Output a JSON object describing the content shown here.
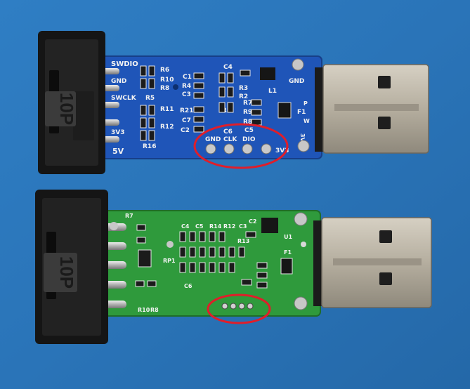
{
  "colors": {
    "background": "#2a74b8",
    "blue_pcb": "#1f55b8",
    "green_pcb": "#2f9a3c",
    "annotation_circle": "#e01e2a",
    "connector_body": "#151515",
    "usb_metal": "#b9b2a4"
  },
  "icons": [
    "10-pin-idc-connector",
    "usb-a-plug",
    "red-annotation-circle"
  ],
  "blue_board": {
    "connector_label": "10P",
    "pin_labels": [
      "SWDIO",
      "GND",
      "SWCLK",
      "3V3",
      "5V"
    ],
    "components": [
      "R6",
      "R10",
      "R8",
      "R5",
      "R11",
      "R12",
      "R16",
      "C1",
      "R4",
      "C3",
      "R21",
      "C7",
      "C2",
      "C4",
      "C6",
      "R3",
      "R2",
      "R1",
      "R7",
      "R9",
      "R8",
      "C5",
      "L1",
      "F1"
    ],
    "pads": [
      "GND",
      "CLK",
      "DIO",
      "3V3"
    ],
    "corner_labels": [
      "GND",
      "P",
      "W",
      "3V3"
    ]
  },
  "green_board": {
    "connector_label": "10P",
    "components": [
      "R7",
      "R10",
      "R8",
      "RP1",
      "C4",
      "C5",
      "R14",
      "C6",
      "R12",
      "R13",
      "C3",
      "C2",
      "F1",
      "U1"
    ]
  }
}
